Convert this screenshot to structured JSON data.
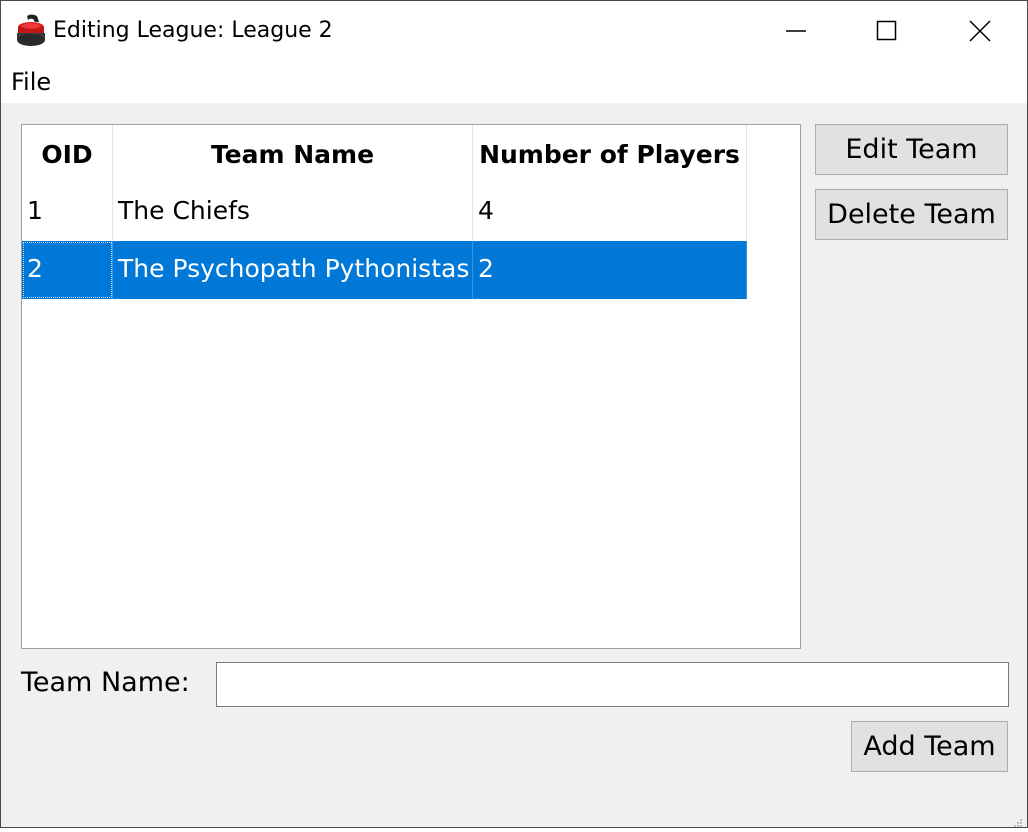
{
  "window": {
    "title": "Editing League: League 2"
  },
  "menu": {
    "file_label": "File"
  },
  "table": {
    "columns": [
      "OID",
      "Team Name",
      "Number of Players"
    ],
    "rows": [
      {
        "oid": "1",
        "team_name": "The Chiefs",
        "players": "4",
        "selected": false
      },
      {
        "oid": "2",
        "team_name": "The Psychopath Pythonistas",
        "players": "2",
        "selected": true
      }
    ]
  },
  "buttons": {
    "edit_team": "Edit Team",
    "delete_team": "Delete Team",
    "add_team": "Add Team"
  },
  "form": {
    "team_name_label": "Team Name:",
    "team_name_value": "",
    "team_name_placeholder": ""
  },
  "colors": {
    "selection": "#0078d7",
    "window_bg": "#f0f0f0",
    "button_bg": "#e1e1e1"
  },
  "icons": {
    "app": "curling-stone-icon",
    "minimize": "minimize-icon",
    "maximize": "maximize-icon",
    "close": "close-icon",
    "grip": "resize-grip-icon"
  }
}
